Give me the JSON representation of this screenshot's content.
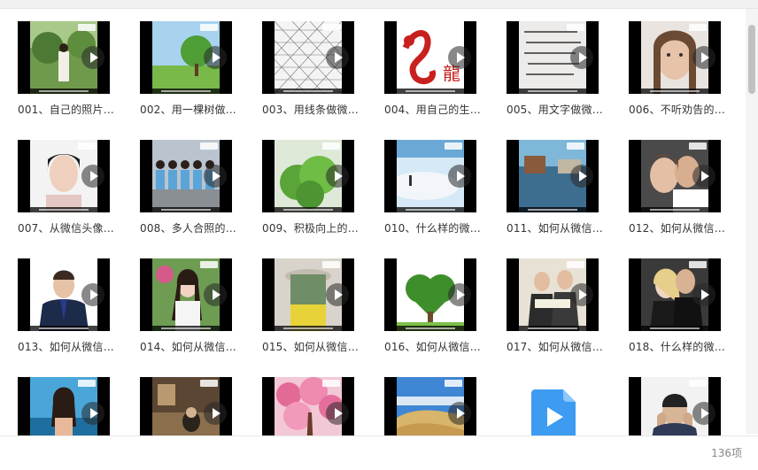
{
  "footer": {
    "item_count": "136项"
  },
  "items": [
    {
      "label": "001、自己的照片…"
    },
    {
      "label": "002、用一棵树做…"
    },
    {
      "label": "003、用线条做微…"
    },
    {
      "label": "004、用自己的生…"
    },
    {
      "label": "005、用文字做微…"
    },
    {
      "label": "006、不听劝告的…"
    },
    {
      "label": "007、从微信头像…"
    },
    {
      "label": "008、多人合照的…"
    },
    {
      "label": "009、积极向上的…"
    },
    {
      "label": "010、什么样的微…"
    },
    {
      "label": "011、如何从微信…"
    },
    {
      "label": "012、如何从微信…"
    },
    {
      "label": "013、如何从微信…"
    },
    {
      "label": "014、如何从微信…"
    },
    {
      "label": "015、如何从微信…"
    },
    {
      "label": "016、如何从微信…"
    },
    {
      "label": "017、如何从微信…"
    },
    {
      "label": "018、什么样的微…"
    },
    {
      "label": ""
    },
    {
      "label": ""
    },
    {
      "label": ""
    },
    {
      "label": ""
    },
    {
      "label": ""
    },
    {
      "label": ""
    }
  ],
  "thumb_art": {
    "004": "龍"
  }
}
